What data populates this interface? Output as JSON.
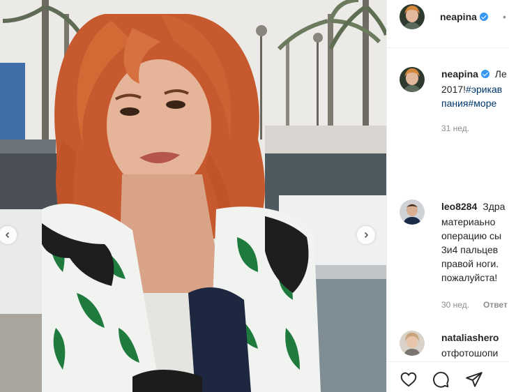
{
  "post": {
    "username": "neapina",
    "caption_lines": [
      "Ле",
      "2017!",
      "пания"
    ],
    "caption_tags": [
      "#эрикав",
      "#море"
    ],
    "caption_time": "31 нед."
  },
  "comments": [
    {
      "username": "leo8284",
      "first_word": "Здра",
      "lines": [
        "материаьно",
        "операцию сы",
        "3и4 пальцев",
        "правой ноги.",
        "пожалуйста!"
      ],
      "time": "30 нед.",
      "reply": "Ответ"
    },
    {
      "username": "nataliashero",
      "lines": [
        "отфотошопи"
      ]
    }
  ],
  "icons": [
    "verified-badge",
    "heart-icon",
    "comment-icon",
    "share-icon",
    "chevron-left-icon",
    "chevron-right-icon"
  ],
  "colors": {
    "link": "#00376b",
    "follow": "#0095f6",
    "muted": "#8e8e8e",
    "verified": "#3897f0"
  }
}
